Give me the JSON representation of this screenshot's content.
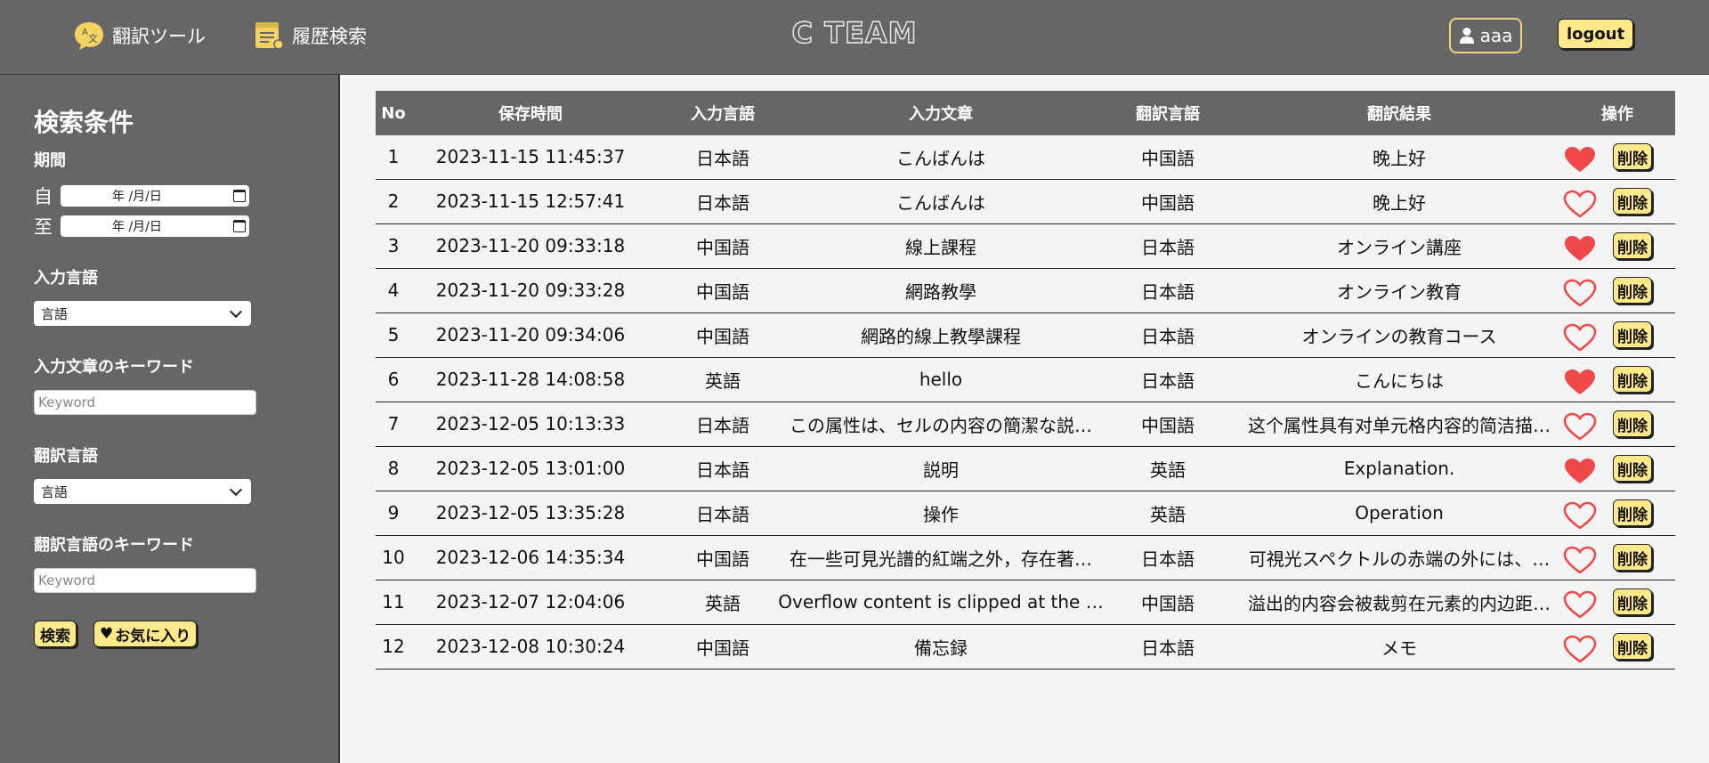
{
  "header": {
    "nav_translate": "翻訳ツール",
    "nav_history": "履歴検索",
    "brand": "C TEAM",
    "user": "aaa",
    "logout": "logout"
  },
  "sidebar": {
    "title": "検索条件",
    "period_label": "期間",
    "from_label": "自",
    "to_label": "至",
    "date_placeholder": "年 /月/日",
    "input_lang_label": "入力言語",
    "input_lang_value": "言語",
    "input_kw_label": "入力文章のキーワード",
    "input_kw_placeholder": "Keyword",
    "output_lang_label": "翻訳言語",
    "output_lang_value": "言語",
    "output_kw_label": "翻訳言語のキーワード",
    "output_kw_placeholder": "Keyword",
    "search_button": "検索",
    "favorites_button": "お気に入り"
  },
  "table": {
    "headers": [
      "No",
      "保存時間",
      "入力言語",
      "入力文章",
      "翻訳言語",
      "翻訳結果",
      "操作"
    ],
    "delete_label": "削除",
    "rows": [
      {
        "no": "1",
        "time": "2023-11-15 11:45:37",
        "in_lang": "日本語",
        "in_text": "こんばんは",
        "out_lang": "中国語",
        "result": "晚上好",
        "favorite": true
      },
      {
        "no": "2",
        "time": "2023-11-15 12:57:41",
        "in_lang": "日本語",
        "in_text": "こんばんは",
        "out_lang": "中国語",
        "result": "晚上好",
        "favorite": false
      },
      {
        "no": "3",
        "time": "2023-11-20 09:33:18",
        "in_lang": "中国語",
        "in_text": "線上課程",
        "out_lang": "日本語",
        "result": "オンライン講座",
        "favorite": true
      },
      {
        "no": "4",
        "time": "2023-11-20 09:33:28",
        "in_lang": "中国語",
        "in_text": "網路教學",
        "out_lang": "日本語",
        "result": "オンライン教育",
        "favorite": false
      },
      {
        "no": "5",
        "time": "2023-11-20 09:34:06",
        "in_lang": "中国語",
        "in_text": "網路的線上教學課程",
        "out_lang": "日本語",
        "result": "オンラインの教育コース",
        "favorite": false
      },
      {
        "no": "6",
        "time": "2023-11-28 14:08:58",
        "in_lang": "英語",
        "in_text": "hello",
        "out_lang": "日本語",
        "result": "こんにちは",
        "favorite": true
      },
      {
        "no": "7",
        "time": "2023-12-05 10:13:33",
        "in_lang": "日本語",
        "in_text": "この属性は、セルの内容の簡潔な説…",
        "out_lang": "中国語",
        "result": "这个属性具有对单元格内容的简洁描…",
        "favorite": false
      },
      {
        "no": "8",
        "time": "2023-12-05 13:01:00",
        "in_lang": "日本語",
        "in_text": "説明",
        "out_lang": "英語",
        "result": "Explanation.",
        "favorite": true
      },
      {
        "no": "9",
        "time": "2023-12-05 13:35:28",
        "in_lang": "日本語",
        "in_text": "操作",
        "out_lang": "英語",
        "result": "Operation",
        "favorite": false
      },
      {
        "no": "10",
        "time": "2023-12-06 14:35:34",
        "in_lang": "中国語",
        "in_text": "在一些可見光譜的紅端之外，存在著…",
        "out_lang": "日本語",
        "result": "可視光スペクトルの赤端の外には、…",
        "favorite": false
      },
      {
        "no": "11",
        "time": "2023-12-07 12:04:06",
        "in_lang": "英語",
        "in_text": "Overflow content is clipped at the …",
        "out_lang": "中国語",
        "result": "溢出的内容会被裁剪在元素的内边距…",
        "favorite": false
      },
      {
        "no": "12",
        "time": "2023-12-08 10:30:24",
        "in_lang": "中国語",
        "in_text": "備忘録",
        "out_lang": "日本語",
        "result": "メモ",
        "favorite": false
      }
    ]
  },
  "colors": {
    "header_bg": "#666666",
    "accent_yellow": "#ffe98a",
    "heart_red": "#f04848",
    "page_bg": "#f4f4f4"
  },
  "icons": {
    "translate": "translate-icon",
    "history": "history-icon",
    "user": "user-icon",
    "heart": "heart-icon",
    "calendar": "calendar-icon"
  }
}
